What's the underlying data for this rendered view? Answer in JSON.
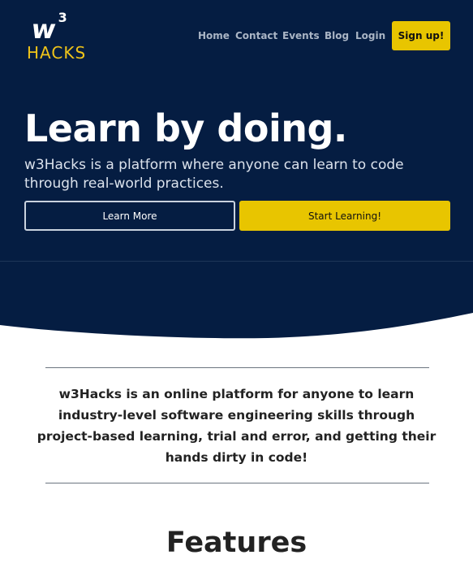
{
  "brand": {
    "logo_mark": "w",
    "logo_sup": "3",
    "logo_wordmark": "HACKS",
    "colors": {
      "navy": "#051d42",
      "yellow": "#e8c500",
      "logo_yellow": "#f0c419"
    }
  },
  "nav": {
    "items": [
      {
        "label": "Home"
      },
      {
        "label": "Contact"
      },
      {
        "label": "Events"
      },
      {
        "label": "Blog"
      },
      {
        "label": "Login"
      }
    ],
    "signup_label": "Sign up!"
  },
  "hero": {
    "title": "Learn by doing.",
    "subtitle": "w3Hacks is a platform where anyone can learn to code through real-world practices.",
    "learn_more_label": "Learn More",
    "start_learning_label": "Start Learning!"
  },
  "about": {
    "text": "w3Hacks is an online platform for anyone to learn industry-level software engineering skills through project-based learning, trial and error, and getting their hands dirty in code!"
  },
  "features": {
    "title": "Features"
  }
}
